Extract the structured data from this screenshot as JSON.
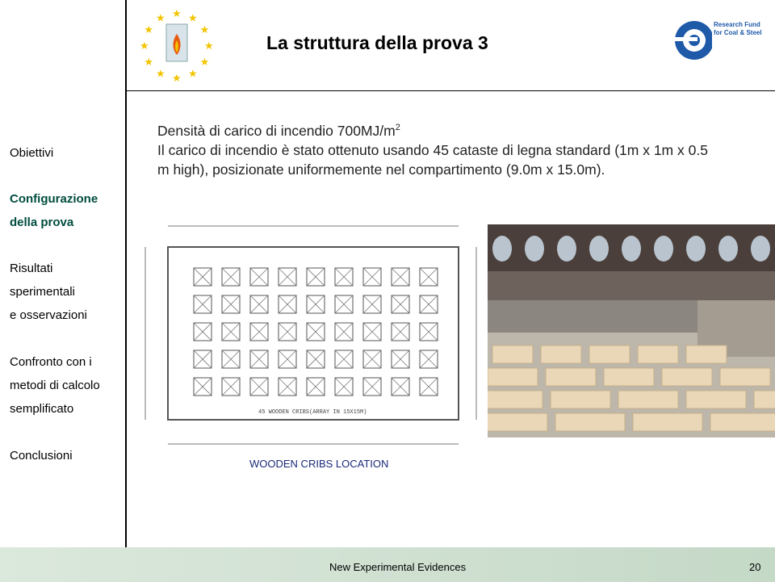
{
  "slide": {
    "title": "La struttura della prova 3",
    "body_line1": "Densità di carico di incendio 700MJ/m",
    "body_line1_sup": "2",
    "body_line2": "Il carico di incendio è stato ottenuto usando 45 cataste di legna standard (1m x 1m x 0.5 m high), posizionate uniformemente nel compartimento (9.0m x 15.0m).",
    "caption": "WOODEN CRIBS LOCATION",
    "plan_label": "45  WOODEN CRIBS(ARRAY IN 15X15M)"
  },
  "nav": {
    "item1": "Obiettivi",
    "item2a": "Configurazione",
    "item2b": "della prova",
    "item3a": "Risultati",
    "item3b": "sperimentali",
    "item3c": "e osservazioni",
    "item4a": "Confronto con i",
    "item4b": "metodi di calcolo",
    "item4c": "semplificato",
    "item5": "Conclusioni"
  },
  "logo_right": {
    "line1": "Research Fund",
    "line2": "for Coal & Steel"
  },
  "footer": {
    "text": "New Experimental Evidences",
    "page": "20"
  },
  "colors": {
    "nav_active": "#004c3f",
    "footer_bg": "#c5d9c7",
    "eu_blue": "#1e5aa8",
    "star_yellow": "#f2c400"
  }
}
